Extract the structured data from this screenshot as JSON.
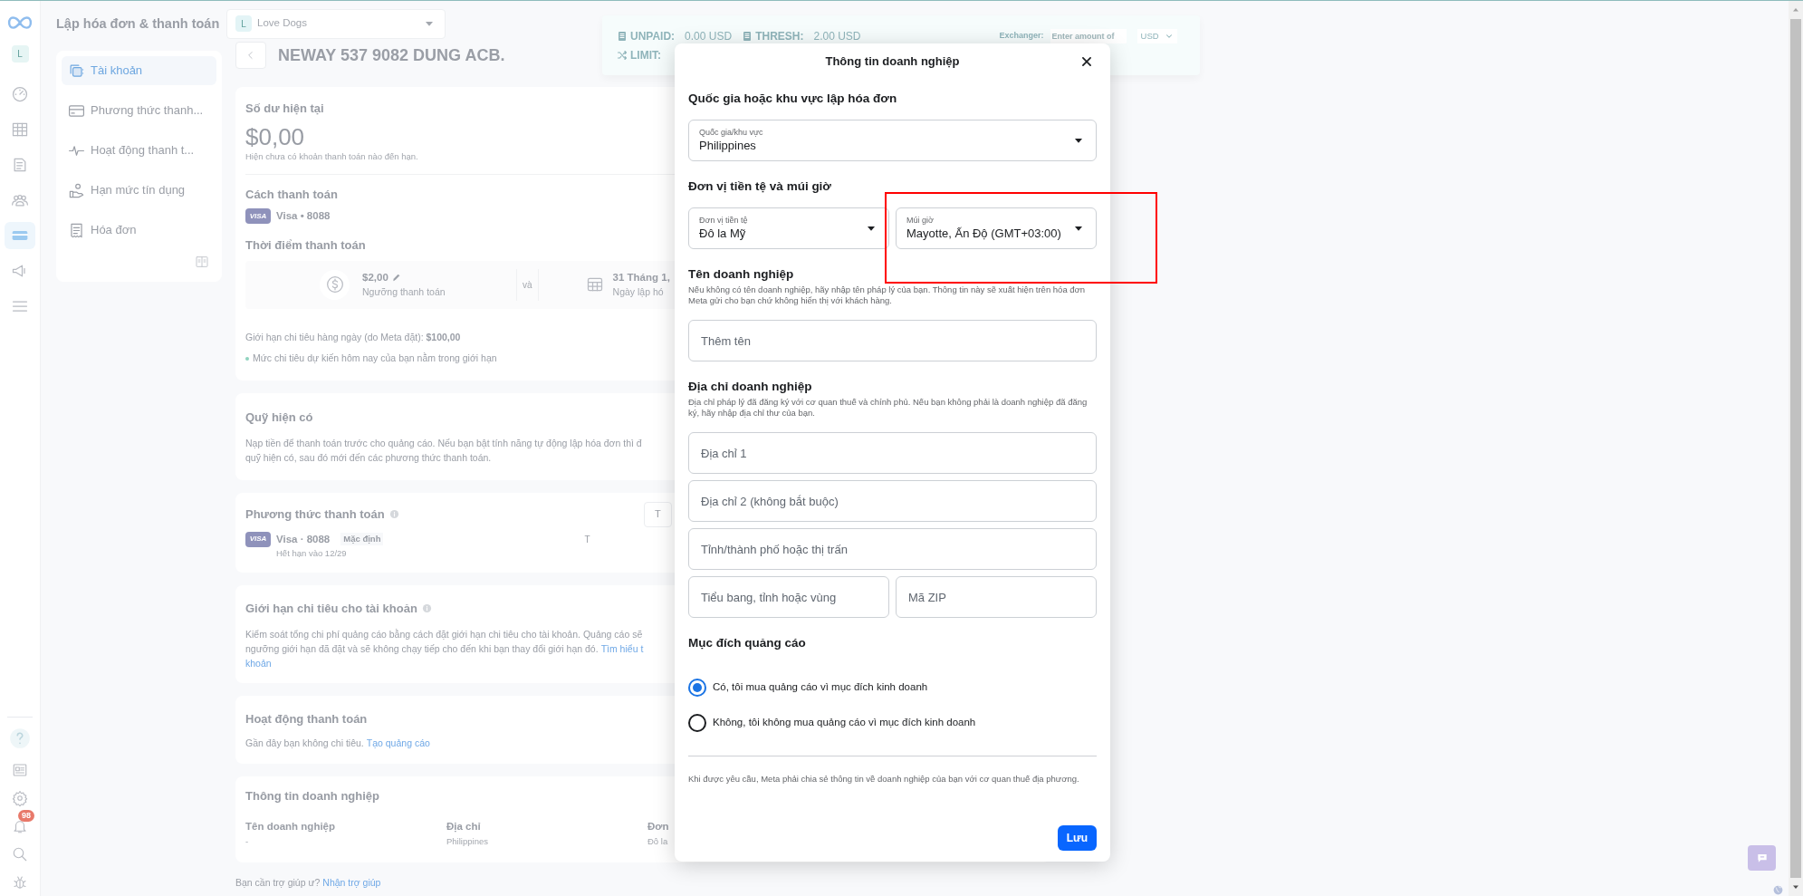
{
  "app": {
    "title": "Lập hóa đơn & thanh toán",
    "account_select": {
      "avatar": "L",
      "value": "Love Dogs"
    }
  },
  "rail": {
    "avatar": "L",
    "items": [
      {
        "selected": false
      },
      {
        "selected": false
      },
      {
        "selected": false
      },
      {
        "selected": false
      },
      {
        "selected": true
      },
      {
        "selected": false
      },
      {
        "selected": false
      }
    ],
    "notification_badge": "98"
  },
  "nav": {
    "items": [
      {
        "label": "Tài khoản",
        "selected": true
      },
      {
        "label": "Phương thức thanh...",
        "selected": false
      },
      {
        "label": "Hoạt động thanh t...",
        "selected": false
      },
      {
        "label": "Hạn mức tín dụng",
        "selected": false
      },
      {
        "label": "Hóa đơn",
        "selected": false
      }
    ]
  },
  "page_title": "NEWAY 537 9082 DUNG ACB.",
  "balance_card": {
    "title": "Số dư hiện tại",
    "amount": "$0,00",
    "note": "Hiện chưa có khoản thanh toán nào đến hạn.",
    "payment_method_title": "Cách thanh toán",
    "card_brand": "VISA",
    "card": "Visa • 8088",
    "timing_title": "Thời điểm thanh toán",
    "threshold_amount": "$2,00",
    "threshold_label": "Ngưỡng thanh toán",
    "connector": "và",
    "bill_date": "31 Tháng 1,",
    "bill_date_label": "Ngày lập hó",
    "daily_limit": "Giới hạn chi tiêu hàng ngày (do Meta đặt): **$100,00**",
    "daily_limit_note": "Mức chi tiêu dự kiến hôm nay của bạn nằm trong giới hạn"
  },
  "prepaid_card": {
    "title": "Quỹ hiện có",
    "lines": [
      "Nạp tiền để thanh toán trước cho quảng cáo. Nếu bạn bật tính năng tự động lập hóa đơn thì đ",
      "quỹ hiện có, sau đó mới đến các phương thức thanh toán."
    ]
  },
  "payment_methods_card": {
    "title": "Phương thức thanh toán",
    "button": "T",
    "card_brand": "VISA",
    "card": "Visa · 8088",
    "default_badge": "Mặc định",
    "expiry": "Hết hạn vào 12/29",
    "column_3": "T"
  },
  "spending_limit_card": {
    "title": "Giới hạn chi tiêu cho tài khoản",
    "lines": [
      "Kiểm soát tổng chi phí quảng cáo bằng cách đặt giới hạn chi tiêu cho tài khoản. Quảng cáo sẽ",
      "ngưỡng giới hạn đã đặt và sẽ không chạy tiếp cho đến khi bạn thay đổi giới hạn đó."
    ],
    "link_lines": [
      "Tìm hiểu t",
      "khoản"
    ]
  },
  "billing_activity_card": {
    "title": "Hoạt động thanh toán",
    "text": "Gần đây bạn không chi tiêu.",
    "link": "Tạo quảng cáo"
  },
  "business_info_card": {
    "title": "Thông tin doanh nghiệp",
    "columns": [
      {
        "label": "Tên doanh nghiệp",
        "value": "-"
      },
      {
        "label": "Địa chỉ",
        "value": "Philippines"
      },
      {
        "label": "Đơn",
        "value": "Đô la"
      }
    ]
  },
  "help": {
    "text": "Bạn cần trợ giúp ư?",
    "link": "Nhận trợ giúp"
  },
  "stats_bar": {
    "unpaid_label": "UNPAID:",
    "unpaid": "0.00 USD",
    "thresh_label": "THRESH:",
    "thresh": "2.00 USD",
    "limit_label": "LIMIT:",
    "exchanger_label": "Exchanger:",
    "exchanger_placeholder": "Enter amount of",
    "currency": "USD"
  },
  "dialog": {
    "title": "Thông tin doanh nghiệp",
    "sections": [
      {
        "kind": "select",
        "heading": "Quốc gia hoặc khu vực lập hóa đơn",
        "fields": [
          {
            "label": "Quốc gia/khu vực",
            "value": "Philippines"
          }
        ]
      },
      {
        "kind": "select",
        "heading": "Đơn vị tiền tệ và múi giờ",
        "fields": [
          {
            "label": "Đơn vị tiền tệ",
            "value": "Đô la Mỹ"
          },
          {
            "label": "Múi giờ",
            "value": "Mayotte, Ấn Độ (GMT+03:00)"
          }
        ]
      },
      {
        "kind": "inputs",
        "heading": "Tên doanh nghiệp",
        "description": "Nếu không có tên doanh nghiệp, hãy nhập tên pháp lý của bạn. Thông tin này sẽ xuất hiện trên hóa đơn Meta gửi cho bạn chứ không hiển thị với khách hàng.",
        "rows": [
          [
            {
              "placeholder": "Thêm tên"
            }
          ]
        ]
      },
      {
        "kind": "inputs",
        "heading": "Địa chỉ doanh nghiệp",
        "description": "Địa chỉ pháp lý đã đăng ký với cơ quan thuế và chính phủ. Nếu bạn không phải là doanh nghiệp đã đăng ký, hãy nhập địa chỉ thư của bạn.",
        "rows": [
          [
            {
              "placeholder": "Địa chỉ 1"
            }
          ],
          [
            {
              "placeholder": "Địa chỉ 2 (không bắt buộc)"
            }
          ],
          [
            {
              "placeholder": "Tỉnh/thành phố hoặc thị trấn"
            }
          ],
          [
            {
              "placeholder": "Tiểu bang, tỉnh hoặc vùng"
            },
            {
              "placeholder": "Mã ZIP"
            }
          ]
        ]
      },
      {
        "kind": "radios",
        "heading": "Mục đích quảng cáo",
        "options": [
          {
            "label": "Có, tôi mua quảng cáo vì mục đích kinh doanh",
            "selected": true
          },
          {
            "label": "Không, tôi không mua quảng cáo vì mục đích kinh doanh",
            "selected": false
          }
        ]
      }
    ],
    "footnote": "Khi được yêu cầu, Meta phải chia sẻ thông tin về doanh nghiệp của bạn với cơ quan thuế địa phương.",
    "save_button": "Lưu"
  }
}
